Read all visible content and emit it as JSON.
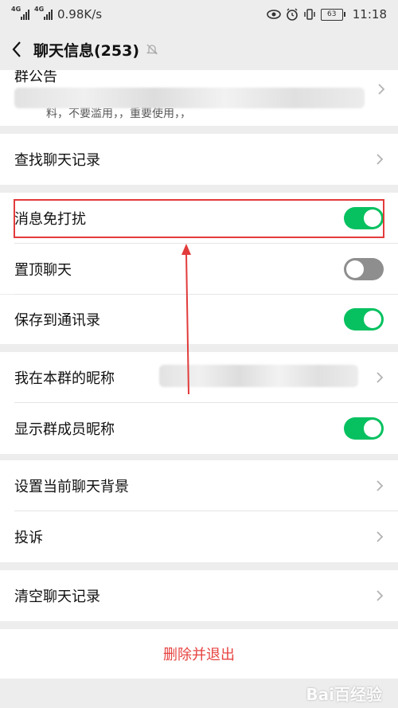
{
  "status_bar": {
    "net1": "4G",
    "net2": "4G",
    "speed": "0.98K/s",
    "battery": "63",
    "time": "11:18"
  },
  "nav": {
    "title": "聊天信息(253)"
  },
  "announcement": {
    "title": "群公告",
    "snippet": "料，不要滥用，，重要使用，，"
  },
  "rows": {
    "search_history": "查找聊天记录",
    "mute": "消息免打扰",
    "pin": "置顶聊天",
    "save_contacts": "保存到通讯录",
    "my_nickname": "我在本群的昵称",
    "show_nicknames": "显示群成员昵称",
    "set_background": "设置当前聊天背景",
    "complain": "投诉",
    "clear_history": "清空聊天记录",
    "delete_exit": "删除并退出"
  },
  "toggles": {
    "mute": true,
    "pin": false,
    "save_contacts": true,
    "show_nicknames": true
  },
  "colors": {
    "toggle_on": "#07c160",
    "toggle_off": "#8e8e8e",
    "danger": "#e64340",
    "highlight": "#e23b3b"
  },
  "watermark": "Bai百经验"
}
